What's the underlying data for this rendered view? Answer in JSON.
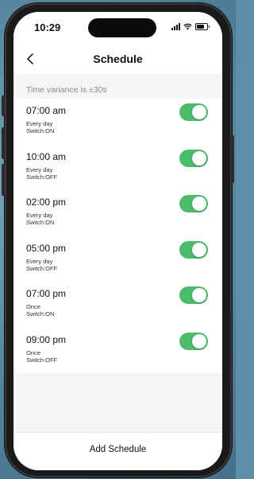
{
  "status_bar": {
    "time": "10:29"
  },
  "nav": {
    "title": "Schedule"
  },
  "variance_text": "Time variance is  ±30s",
  "schedules": [
    {
      "time": "07:00 am",
      "repeat": "Every day",
      "switch": "Switch:ON",
      "enabled": true
    },
    {
      "time": "10:00 am",
      "repeat": "Every day",
      "switch": "Switch:OFF",
      "enabled": true
    },
    {
      "time": "02:00 pm",
      "repeat": "Every day",
      "switch": "Switch:ON",
      "enabled": true
    },
    {
      "time": "05:00 pm",
      "repeat": "Every day",
      "switch": "Switch:OFF",
      "enabled": true
    },
    {
      "time": "07:00 pm",
      "repeat": "Once",
      "switch": "Switch:ON",
      "enabled": true
    },
    {
      "time": "09:00 pm",
      "repeat": "Once",
      "switch": "Switch:OFF",
      "enabled": true
    }
  ],
  "footer": {
    "add_label": "Add Schedule"
  },
  "colors": {
    "toggle_on": "#4cbb6c",
    "background": "#f5f5f7"
  },
  "icons": {
    "back": "chevron-left-icon",
    "signal": "signal-icon",
    "wifi": "wifi-icon",
    "battery": "battery-icon"
  }
}
